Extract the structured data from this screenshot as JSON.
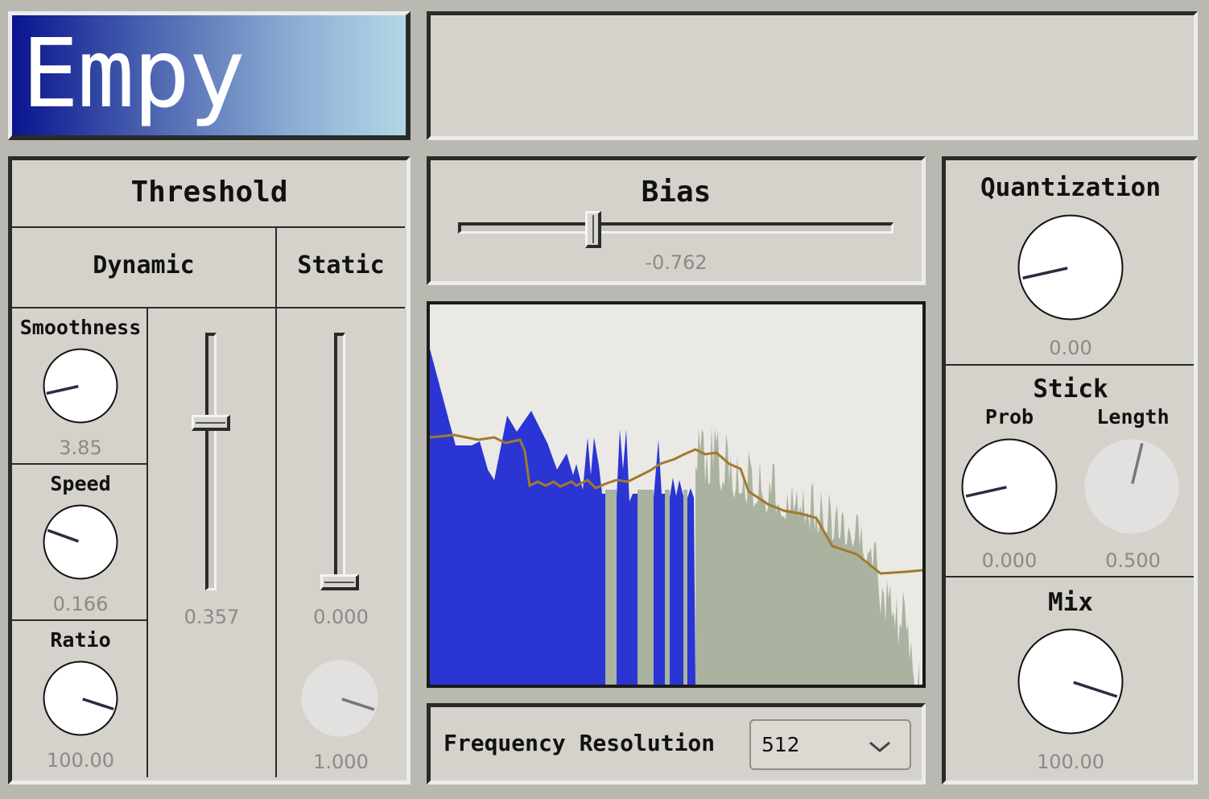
{
  "app": {
    "title": "Empy",
    "header_display": ""
  },
  "threshold": {
    "title": "Threshold",
    "dynamic": {
      "label": "Dynamic",
      "smoothness": {
        "label": "Smoothness",
        "value": "3.85",
        "level": 0.12
      },
      "speed": {
        "label": "Speed",
        "value": "0.166",
        "level": 0.24
      },
      "ratio": {
        "label": "Ratio",
        "value": "100.00",
        "level": 0.9
      },
      "slider": {
        "value": "0.357",
        "level": 0.62
      }
    },
    "static": {
      "label": "Static",
      "slider": {
        "value": "0.000",
        "level": 0.0
      },
      "knob": {
        "value": "1.000",
        "level": 0.9
      }
    }
  },
  "bias": {
    "label": "Bias",
    "value": "-0.762",
    "level": 0.31
  },
  "spectrum": {
    "curve_color": "#a07a2c",
    "fill_color": "#2a35d4",
    "noise_color": "#aab2a0"
  },
  "frequency_resolution": {
    "label": "Frequency Resolution",
    "selected": "512",
    "icon": "chevron-down-icon"
  },
  "quantization": {
    "label": "Quantization",
    "value": "0.00",
    "level": 0.12
  },
  "stick": {
    "label": "Stick",
    "prob": {
      "label": "Prob",
      "value": "0.000",
      "level": 0.12
    },
    "length": {
      "label": "Length",
      "value": "0.500",
      "level": 0.55
    }
  },
  "mix": {
    "label": "Mix",
    "value": "100.00",
    "level": 0.9
  }
}
